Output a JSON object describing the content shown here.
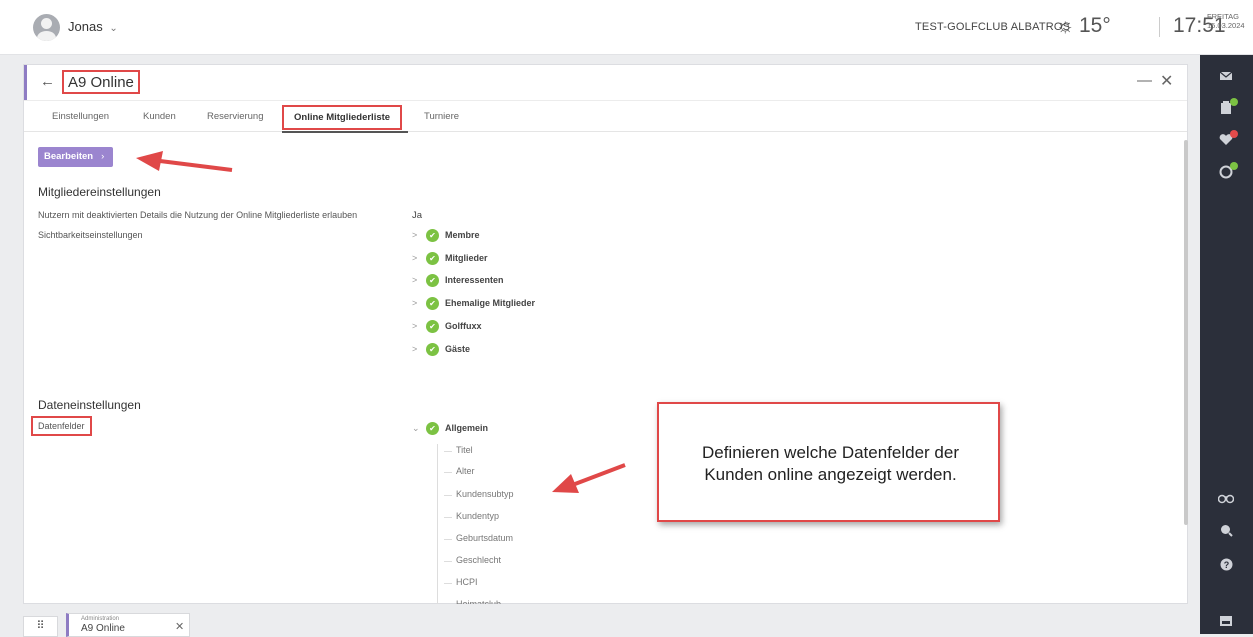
{
  "topbar": {
    "user_name": "Jonas",
    "user_caret": "⌄",
    "club_name": "TEST-GOLFCLUB ALBATROS",
    "weather_icon": "sun-icon",
    "weather_glyph": "☼",
    "temperature": "15°",
    "time": "17:51",
    "weekday": "FREITAG",
    "date": "15.03.2024"
  },
  "panel": {
    "back": "←",
    "title": "A9 Online",
    "minimize": "—",
    "close": "✕",
    "tabs": [
      {
        "label": "Einstellungen"
      },
      {
        "label": "Kunden"
      },
      {
        "label": "Reservierung"
      },
      {
        "label": "Online Mitgliederliste"
      },
      {
        "label": "Turniere"
      }
    ],
    "active_tab": "Online Mitgliederliste",
    "edit_button": "Bearbeiten",
    "edit_chevron": "›",
    "member_settings": {
      "heading": "Mitgliedereinstellungen",
      "rows": [
        {
          "label": "Nutzern mit deaktivierten Details die Nutzung der Online Mitgliederliste erlauben",
          "value": "Ja"
        },
        {
          "label": "Sichtbarkeitseinstellungen"
        }
      ],
      "groups": [
        "Membre",
        "Mitglieder",
        "Interessenten",
        "Ehemalige Mitglieder",
        "Golffuxx",
        "Gäste"
      ]
    },
    "data_settings": {
      "heading": "Dateneinstellungen",
      "label": "Datenfelder",
      "group": "Allgemein",
      "fields": [
        "Titel",
        "Alter",
        "Kundensubtyp",
        "Kundentyp",
        "Geburtsdatum",
        "Geschlecht",
        "HCPI",
        "Heimatclub"
      ]
    }
  },
  "callout": {
    "text": "Definieren welche Datenfelder der\nKunden online angezeigt werden."
  },
  "taskbar": {
    "apps_glyph": "⠿",
    "task_category": "Administration",
    "task_name": "A9 Online",
    "task_close": "✕"
  },
  "colors": {
    "accent": "#8e7cc3",
    "check": "#7cc243",
    "highlight": "#e04848",
    "sidebar": "#2b2f3a"
  }
}
